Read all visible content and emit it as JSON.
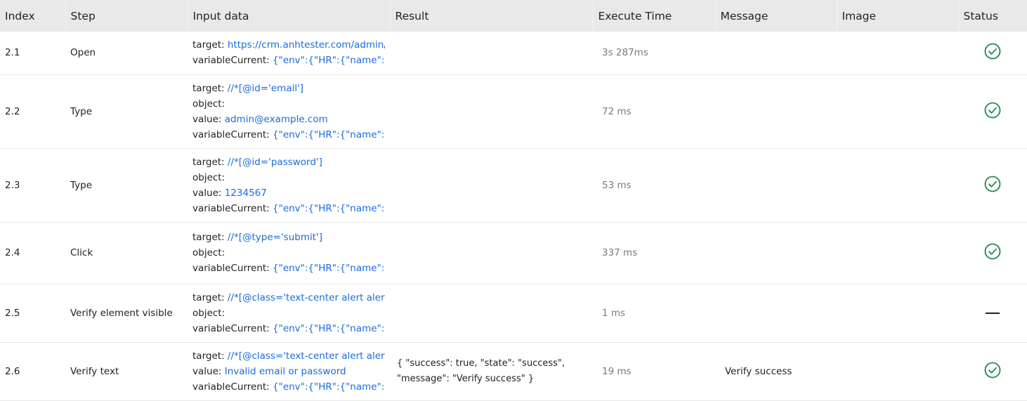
{
  "headers": [
    "Index",
    "Step",
    "Input data",
    "Result",
    "Execute Time",
    "Message",
    "Image",
    "Status"
  ],
  "colors": {
    "link": "#1a6ce0",
    "pass": "#1e8a52",
    "header_bg": "#e9e9e9"
  },
  "rows": [
    {
      "index": "2.1",
      "step": "Open",
      "inputs": [
        {
          "key": "target: ",
          "value": "https://crm.anhtester.com/admin/..."
        },
        {
          "key": "variableCurrent: ",
          "value": "{\"env\":{\"HR\":{\"name\":\"HR\"..."
        }
      ],
      "result": "",
      "time": "3s 287ms",
      "message": "",
      "image": "",
      "status": "pass"
    },
    {
      "index": "2.2",
      "step": "Type",
      "inputs": [
        {
          "key": "target: ",
          "value": "//*[@id='email']"
        },
        {
          "key": "object: ",
          "value": ""
        },
        {
          "key": "value: ",
          "value": "admin@example.com"
        },
        {
          "key": "variableCurrent: ",
          "value": "{\"env\":{\"HR\":{\"name\":\"HR\"..."
        }
      ],
      "result": "",
      "time": "72 ms",
      "message": "",
      "image": "",
      "status": "pass"
    },
    {
      "index": "2.3",
      "step": "Type",
      "inputs": [
        {
          "key": "target: ",
          "value": "//*[@id='password']"
        },
        {
          "key": "object: ",
          "value": ""
        },
        {
          "key": "value: ",
          "value": "1234567"
        },
        {
          "key": "variableCurrent: ",
          "value": "{\"env\":{\"HR\":{\"name\":\"HR\"..."
        }
      ],
      "result": "",
      "time": "53 ms",
      "message": "",
      "image": "",
      "status": "pass"
    },
    {
      "index": "2.4",
      "step": "Click",
      "inputs": [
        {
          "key": "target: ",
          "value": "//*[@type='submit']"
        },
        {
          "key": "object: ",
          "value": ""
        },
        {
          "key": "variableCurrent: ",
          "value": "{\"env\":{\"HR\":{\"name\":\"HR\"..."
        }
      ],
      "result": "",
      "time": "337 ms",
      "message": "",
      "image": "",
      "status": "pass"
    },
    {
      "index": "2.5",
      "step": "Verify element visible",
      "inputs": [
        {
          "key": "target: ",
          "value": "//*[@class='text-center alert alert-..."
        },
        {
          "key": "object: ",
          "value": ""
        },
        {
          "key": "variableCurrent: ",
          "value": "{\"env\":{\"HR\":{\"name\":\"HR\"..."
        }
      ],
      "result": "",
      "time": "1 ms",
      "message": "",
      "image": "",
      "status": "skipped"
    },
    {
      "index": "2.6",
      "step": "Verify text",
      "inputs": [
        {
          "key": "target: ",
          "value": "//*[@class='text-center alert alert-..."
        },
        {
          "key": "value: ",
          "value": "Invalid email or password"
        },
        {
          "key": "variableCurrent: ",
          "value": "{\"env\":{\"HR\":{\"name\":\"HR\"..."
        }
      ],
      "result": "{ \"success\": true, \"state\": \"success\", \"message\": \"Verify success\" }",
      "time": "19 ms",
      "message": "Verify success",
      "image": "",
      "status": "pass"
    }
  ]
}
